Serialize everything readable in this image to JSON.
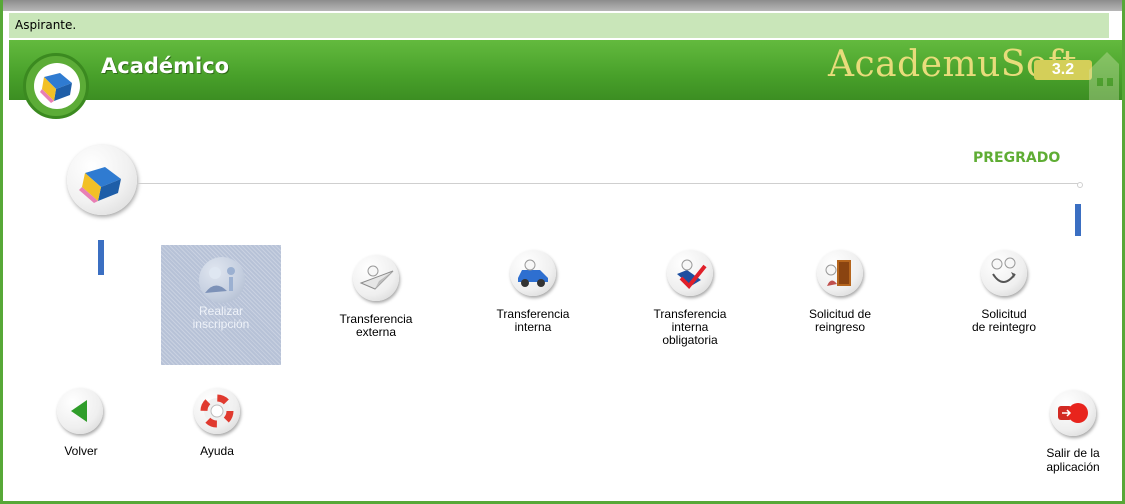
{
  "status_bar": {
    "text": "Aspirante."
  },
  "header": {
    "module_title": "Académico",
    "brand": "AcademuSoft",
    "brand_version": "3.2"
  },
  "section": {
    "label": "PREGRADO"
  },
  "actions": [
    {
      "label": "Realizar\ninscripción",
      "icon": "user-register-icon",
      "selected": true
    },
    {
      "label": "Transferencia\nexterna",
      "icon": "paper-plane-icon"
    },
    {
      "label": "Transferencia\ninterna",
      "icon": "car-icon"
    },
    {
      "label": "Transferencia\ninterna\nobligatoria",
      "icon": "checkmark-icon"
    },
    {
      "label": "Solicitud de\nreingreso",
      "icon": "door-icon"
    },
    {
      "label": "Solicitud\nde reintegro",
      "icon": "return-arrow-icon"
    }
  ],
  "nav": {
    "back_label": "Volver",
    "help_label": "Ayuda",
    "exit_label": "Salir de la\naplicación"
  },
  "colors": {
    "banner_green": "#4fa82f",
    "section_label_green": "#5fad34",
    "marker_blue": "#3b6fc2",
    "brand_gold": "#e8dc7b",
    "selected_tile": "#b7c2d7"
  }
}
